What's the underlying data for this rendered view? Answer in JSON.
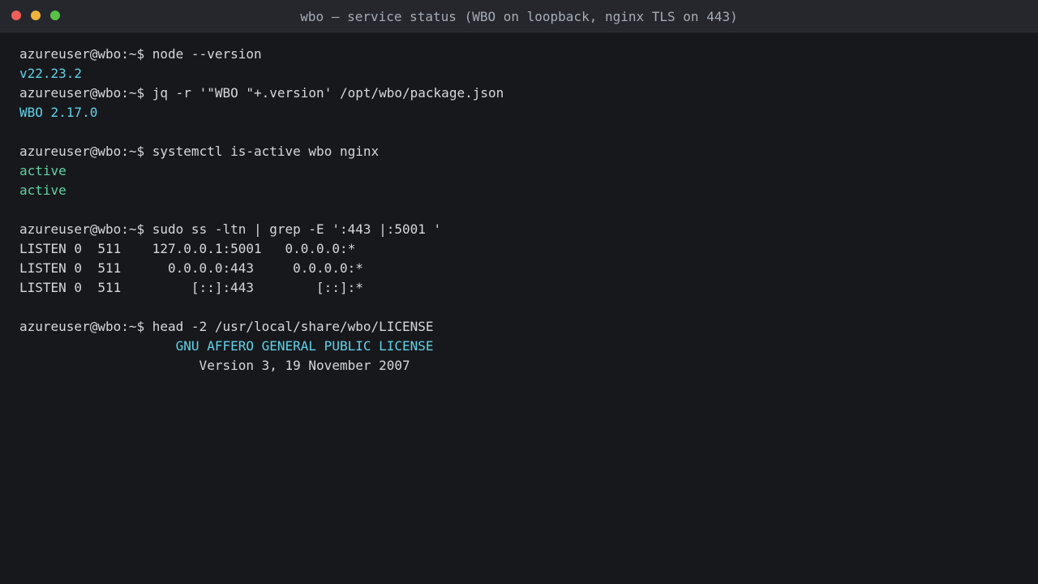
{
  "window": {
    "title": "wbo — service status (WBO on loopback, nginx TLS on 443)"
  },
  "prompt": "azureuser@wbo:~$ ",
  "lines": {
    "cmd1": "node --version",
    "out1": "v22.23.2",
    "cmd2": "jq -r '\"WBO \"+.version' /opt/wbo/package.json",
    "out2": "WBO 2.17.0",
    "cmd3": "systemctl is-active wbo nginx",
    "out3a": "active",
    "out3b": "active",
    "cmd4": "sudo ss -ltn | grep -E ':443 |:5001 '",
    "out4a": "LISTEN 0  511    127.0.0.1:5001   0.0.0.0:*",
    "out4b": "LISTEN 0  511      0.0.0.0:443     0.0.0.0:*",
    "out4c": "LISTEN 0  511         [::]:443        [::]:*",
    "cmd5": "head -2 /usr/local/share/wbo/LICENSE",
    "out5a": "                    GNU AFFERO GENERAL PUBLIC LICENSE",
    "out5b": "                       Version 3, 19 November 2007"
  },
  "colors": {
    "background": "#17181c",
    "titlebar": "#25272d",
    "text": "#d6d8dc",
    "version_output": "#5fd3e8",
    "active_output": "#5ed3a3"
  }
}
